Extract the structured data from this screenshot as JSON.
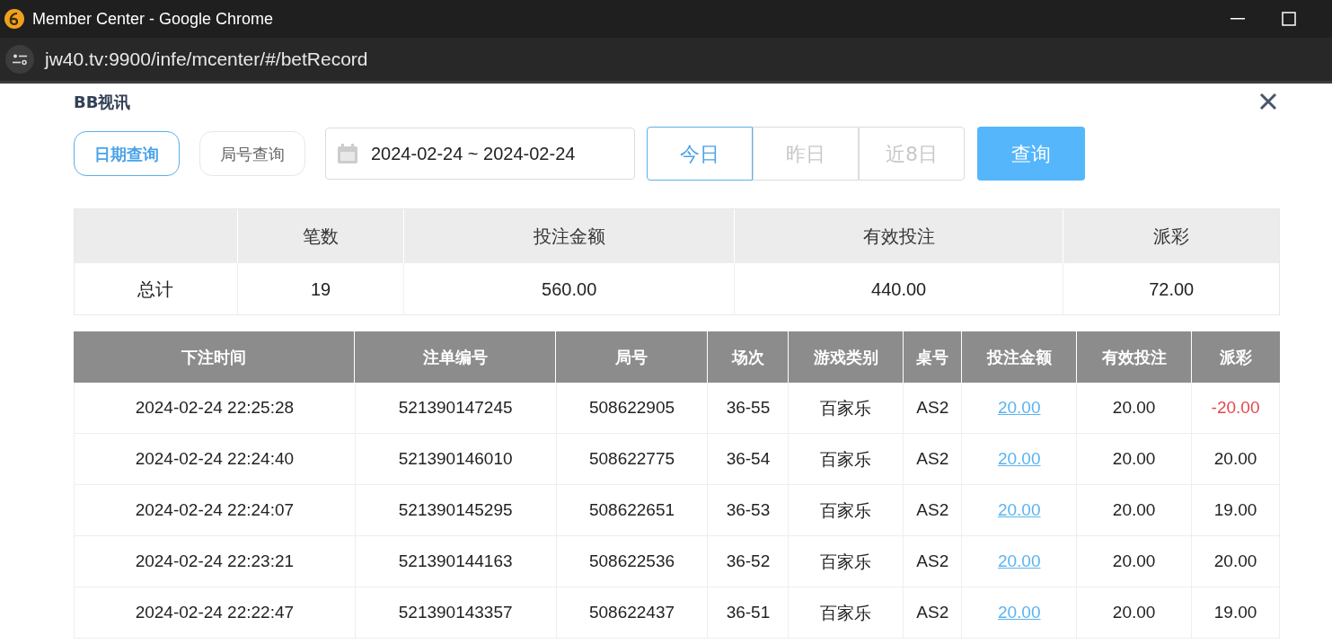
{
  "window": {
    "title": "Member Center - Google Chrome"
  },
  "address_bar": {
    "url": "jw40.tv:9900/infe/mcenter/#/betRecord"
  },
  "panel": {
    "title": "BB视讯"
  },
  "query_modes": [
    {
      "label": "日期查询",
      "selected": true
    },
    {
      "label": "局号查询",
      "selected": false
    }
  ],
  "date_range": {
    "value": "2024-02-24 ~ 2024-02-24"
  },
  "quick_dates": [
    {
      "label": "今日",
      "selected": true
    },
    {
      "label": "昨日",
      "selected": false
    },
    {
      "label": "近8日",
      "selected": false
    }
  ],
  "search_button": "查询",
  "summary": {
    "columns": [
      "",
      "笔数",
      "投注金额",
      "有效投注",
      "派彩"
    ],
    "row": [
      "总计",
      "19",
      "560.00",
      "440.00",
      "72.00"
    ]
  },
  "table": {
    "columns": [
      "下注时间",
      "注单编号",
      "局号",
      "场次",
      "游戏类别",
      "桌号",
      "投注金额",
      "有效投注",
      "派彩"
    ],
    "rows": [
      {
        "time": "2024-02-24 22:25:28",
        "bet_id": "521390147245",
        "round": "508622905",
        "session": "36-55",
        "game": "百家乐",
        "table_no": "AS2",
        "amount": "20.00",
        "valid": "20.00",
        "payout": "-20.00",
        "loss": true
      },
      {
        "time": "2024-02-24 22:24:40",
        "bet_id": "521390146010",
        "round": "508622775",
        "session": "36-54",
        "game": "百家乐",
        "table_no": "AS2",
        "amount": "20.00",
        "valid": "20.00",
        "payout": "20.00",
        "loss": false
      },
      {
        "time": "2024-02-24 22:24:07",
        "bet_id": "521390145295",
        "round": "508622651",
        "session": "36-53",
        "game": "百家乐",
        "table_no": "AS2",
        "amount": "20.00",
        "valid": "20.00",
        "payout": "19.00",
        "loss": false
      },
      {
        "time": "2024-02-24 22:23:21",
        "bet_id": "521390144163",
        "round": "508622536",
        "session": "36-52",
        "game": "百家乐",
        "table_no": "AS2",
        "amount": "20.00",
        "valid": "20.00",
        "payout": "20.00",
        "loss": false
      },
      {
        "time": "2024-02-24 22:22:47",
        "bet_id": "521390143357",
        "round": "508622437",
        "session": "36-51",
        "game": "百家乐",
        "table_no": "AS2",
        "amount": "20.00",
        "valid": "20.00",
        "payout": "19.00",
        "loss": false
      }
    ]
  }
}
